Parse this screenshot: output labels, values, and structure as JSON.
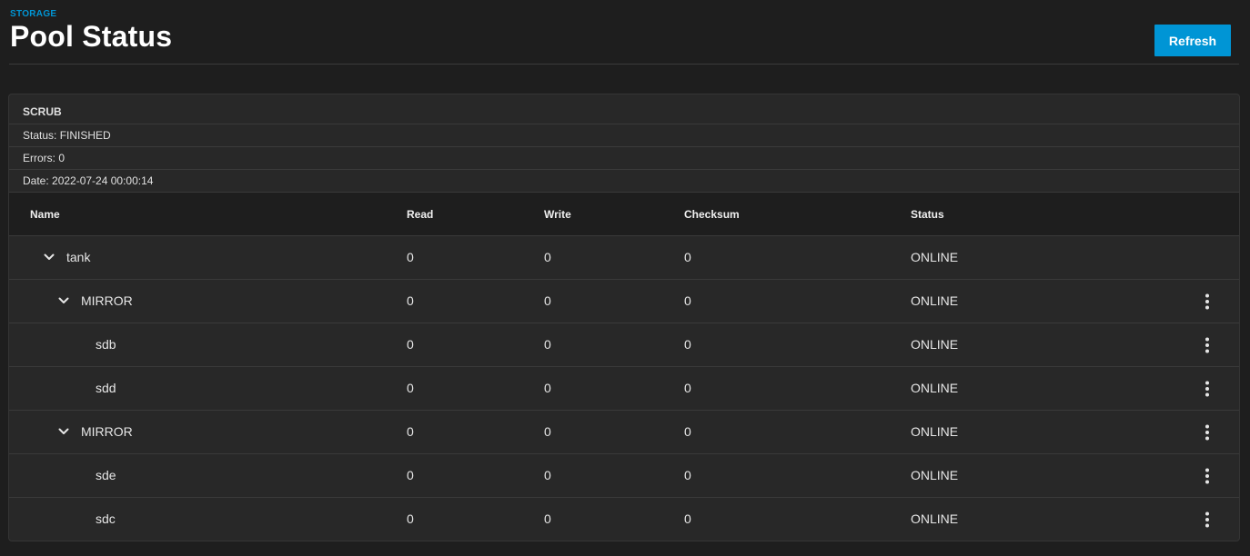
{
  "breadcrumb": "STORAGE",
  "title": "Pool Status",
  "refresh_label": "Refresh",
  "scrub": {
    "title": "SCRUB",
    "status": "Status: FINISHED",
    "errors": "Errors: 0",
    "date": "Date: 2022-07-24 00:00:14"
  },
  "columns": {
    "name": "Name",
    "read": "Read",
    "write": "Write",
    "checksum": "Checksum",
    "status": "Status"
  },
  "rows": [
    {
      "name": "tank",
      "read": "0",
      "write": "0",
      "checksum": "0",
      "status": "ONLINE",
      "level": 0,
      "expandable": true,
      "menu": false
    },
    {
      "name": "MIRROR",
      "read": "0",
      "write": "0",
      "checksum": "0",
      "status": "ONLINE",
      "level": 1,
      "expandable": true,
      "menu": true
    },
    {
      "name": "sdb",
      "read": "0",
      "write": "0",
      "checksum": "0",
      "status": "ONLINE",
      "level": 2,
      "expandable": false,
      "menu": true
    },
    {
      "name": "sdd",
      "read": "0",
      "write": "0",
      "checksum": "0",
      "status": "ONLINE",
      "level": 2,
      "expandable": false,
      "menu": true
    },
    {
      "name": "MIRROR",
      "read": "0",
      "write": "0",
      "checksum": "0",
      "status": "ONLINE",
      "level": 1,
      "expandable": true,
      "menu": true
    },
    {
      "name": "sde",
      "read": "0",
      "write": "0",
      "checksum": "0",
      "status": "ONLINE",
      "level": 2,
      "expandable": false,
      "menu": true
    },
    {
      "name": "sdc",
      "read": "0",
      "write": "0",
      "checksum": "0",
      "status": "ONLINE",
      "level": 2,
      "expandable": false,
      "menu": true
    }
  ],
  "icons": {
    "expand": "chevron-down-icon",
    "menu": "more-vertical-icon"
  },
  "colors": {
    "accent": "#0095d5",
    "background": "#1e1e1e",
    "card": "#282828"
  }
}
